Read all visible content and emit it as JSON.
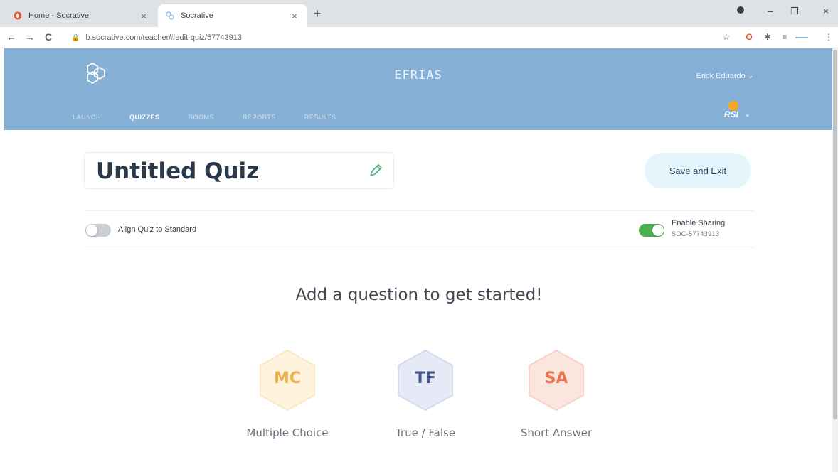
{
  "browser": {
    "tabs": [
      {
        "title": "Home - Socrative",
        "icon": "opera-icon",
        "close": "×"
      },
      {
        "title": "Socrative",
        "icon": "socrative-icon",
        "close": "×"
      }
    ],
    "new_tab": "+",
    "window_controls": {
      "minimize": "–",
      "maximize": "❐",
      "close": "×"
    },
    "nav": {
      "back": "←",
      "forward": "→",
      "reload": "C"
    },
    "url": "b.socrative.com/teacher/#edit-quiz/57743913",
    "lock": "🔒",
    "toolbar_icons": [
      "star-icon",
      "opera-icon",
      "extensions-icon",
      "playlist-icon",
      "menu-icon"
    ],
    "toolbar_glyphs": [
      "☆",
      "O",
      "✱",
      "≡",
      "⋮"
    ]
  },
  "header": {
    "room_name": "EFRIAS",
    "user_name": "Erick Eduardo",
    "user_chevron": "⌄",
    "nav_tabs": [
      "LAUNCH",
      "QUIZZES",
      "ROOMS",
      "REPORTS",
      "RESULTS"
    ],
    "active_tab": "QUIZZES",
    "avatar_text": "RSI",
    "colors": {
      "header_bg": "#86afd6",
      "accent": "#f5a623"
    }
  },
  "quiz": {
    "title": "Untitled Quiz",
    "save_label": "Save and Exit",
    "align_label": "Align Quiz to Standard",
    "align_enabled": false,
    "sharing_label": "Enable Sharing",
    "sharing_enabled": true,
    "share_code": "SOC-57743913"
  },
  "prompt": "Add a question to get started!",
  "question_types": [
    {
      "abbr": "MC",
      "label": "Multiple Choice",
      "color": "#f0b04a",
      "bg": "#fdf3df"
    },
    {
      "abbr": "TF",
      "label": "True / False",
      "color": "#4a5a8a",
      "bg": "#e6eaf6"
    },
    {
      "abbr": "SA",
      "label": "Short Answer",
      "color": "#e8724a",
      "bg": "#fbe6df"
    }
  ]
}
